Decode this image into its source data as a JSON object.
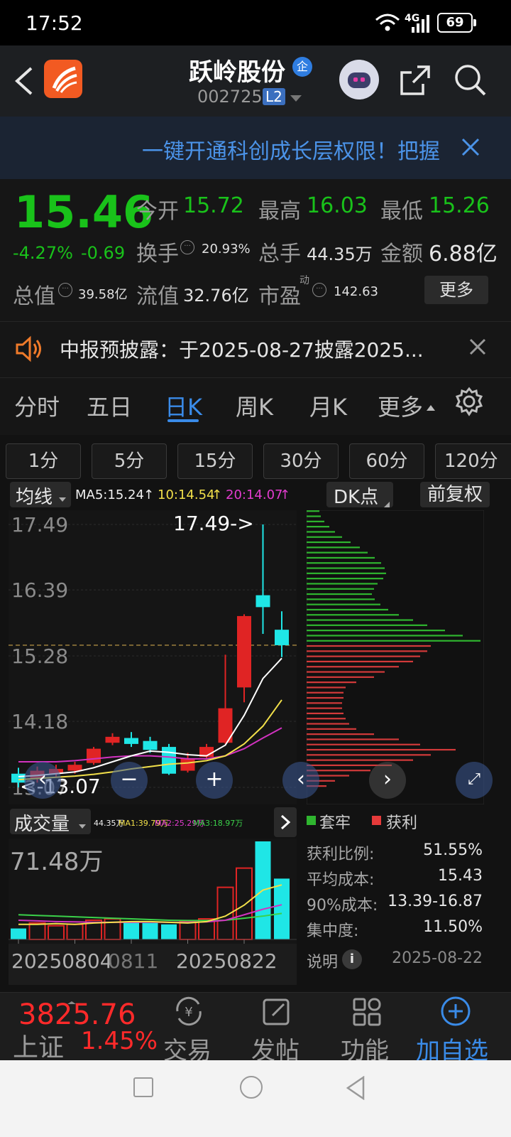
{
  "status_bar": {
    "time": "17:52",
    "network": "4G",
    "battery": "69"
  },
  "header": {
    "stock_name": "跃岭股份",
    "enterprise_badge": "企",
    "stock_code": "002725",
    "level_badge": "L2"
  },
  "banner": {
    "text": "一键开通科创成长层权限！把握"
  },
  "quote": {
    "price": "15.46",
    "change_pct": "-4.27%",
    "change": "-0.69",
    "open_label": "今开",
    "open": "15.72",
    "high_label": "最高",
    "high": "16.03",
    "low_label": "最低",
    "low": "15.26",
    "turnover_label": "换手",
    "turnover": "20.93%",
    "volume_label": "总手",
    "volume": "44.35万",
    "amount_label": "金额",
    "amount": "6.88亿",
    "mktcap_label": "总值",
    "mktcap": "39.58亿",
    "float_label": "流值",
    "float_cap": "32.76亿",
    "pe_label": "市盈",
    "pe_sup": "动",
    "pe": "142.63",
    "more_button": "更多"
  },
  "notice": {
    "text": "中报预披露：于2025-08-27披露2025..."
  },
  "tabs": [
    "分时",
    "五日",
    "日K",
    "周K",
    "月K",
    "更多"
  ],
  "active_tab": "日K",
  "periods": [
    "1分",
    "5分",
    "15分",
    "30分",
    "60分",
    "120分"
  ],
  "chart_toolbar": {
    "ma_select": "均线",
    "ma5": "MA5:15.24",
    "ma10": "10:14.54",
    "ma20": "20:14.07",
    "dk_button": "DK点",
    "adjust_button": "前复权"
  },
  "volume_panel": {
    "select": "成交量",
    "vol": "44.35万",
    "ma1": "MA1:39.79万",
    "ma2": "MA2:25.29万",
    "ma3": "MA3:18.97万",
    "max_label": "71.48万",
    "date_left": "20250804",
    "date_left2": "0811",
    "date_right": "20250822"
  },
  "chip_panel": {
    "legend_trapped": "套牢",
    "legend_profit": "获利",
    "rows": [
      {
        "label": "获利比例:",
        "value": "51.55%"
      },
      {
        "label": "平均成本:",
        "value": "15.43"
      },
      {
        "label": "90%成本:",
        "value": "13.39-16.87"
      },
      {
        "label": "集中度:",
        "value": "11.50%"
      }
    ],
    "note_label": "说明",
    "date": "2025-08-22"
  },
  "bottom_bar": {
    "index_value": "3825.76",
    "index_name": "上证",
    "index_pct": "1.45%",
    "trade": "交易",
    "post": "发帖",
    "functions": "功能",
    "add_watch": "加自选"
  },
  "chart_data": {
    "type": "candlestick",
    "y_ticks": [
      "17.49",
      "16.39",
      "15.28",
      "14.18",
      "13.07"
    ],
    "ylim": [
      13.07,
      17.49
    ],
    "high_annotation": "17.49->",
    "low_annotation": "<-13.07",
    "candles": [
      {
        "o": 13.3,
        "c": 13.15,
        "h": 13.4,
        "l": 13.07
      },
      {
        "o": 13.22,
        "c": 13.35,
        "h": 13.42,
        "l": 13.15
      },
      {
        "o": 13.3,
        "c": 13.38,
        "h": 13.45,
        "l": 13.25
      },
      {
        "o": 13.35,
        "c": 13.45,
        "h": 13.5,
        "l": 13.3
      },
      {
        "o": 13.48,
        "c": 13.72,
        "h": 13.75,
        "l": 13.45
      },
      {
        "o": 13.82,
        "c": 13.92,
        "h": 13.98,
        "l": 13.78
      },
      {
        "o": 13.9,
        "c": 13.8,
        "h": 14.0,
        "l": 13.75
      },
      {
        "o": 13.85,
        "c": 13.7,
        "h": 13.92,
        "l": 13.65
      },
      {
        "o": 13.75,
        "c": 13.3,
        "h": 13.8,
        "l": 13.28
      },
      {
        "o": 13.35,
        "c": 13.55,
        "h": 13.65,
        "l": 13.32
      },
      {
        "o": 13.58,
        "c": 13.75,
        "h": 13.8,
        "l": 13.55
      },
      {
        "o": 13.82,
        "c": 14.4,
        "h": 15.3,
        "l": 13.8
      },
      {
        "o": 14.75,
        "c": 15.95,
        "h": 15.98,
        "l": 14.5
      },
      {
        "o": 16.3,
        "c": 16.1,
        "h": 17.49,
        "l": 15.65
      },
      {
        "o": 15.72,
        "c": 15.46,
        "h": 16.03,
        "l": 15.26
      }
    ],
    "ma5": [
      13.25,
      13.27,
      13.3,
      13.33,
      13.4,
      13.5,
      13.6,
      13.68,
      13.66,
      13.62,
      13.6,
      13.78,
      14.28,
      14.9,
      15.24
    ],
    "ma10": [
      13.2,
      13.22,
      13.24,
      13.26,
      13.29,
      13.33,
      13.38,
      13.42,
      13.46,
      13.48,
      13.52,
      13.6,
      13.8,
      14.1,
      14.54
    ],
    "ma20": [
      13.5,
      13.5,
      13.5,
      13.52,
      13.55,
      13.58,
      13.6,
      13.6,
      13.58,
      13.55,
      13.55,
      13.6,
      13.72,
      13.9,
      14.07
    ],
    "price_line": 15.46,
    "volume": [
      8,
      12,
      10,
      11,
      14,
      15,
      13,
      12,
      11,
      13,
      15,
      38,
      52,
      71.48,
      44.35
    ],
    "vol_ma1": [
      11,
      11,
      11.5,
      11,
      12,
      12.5,
      13,
      13,
      12.5,
      12,
      13,
      17,
      25,
      36,
      39.79
    ],
    "vol_ma2": [
      14,
      13.5,
      13,
      12.8,
      12.5,
      12.5,
      12.5,
      12.6,
      12.5,
      12.5,
      12.8,
      14,
      18,
      22,
      25.29
    ],
    "vol_ma3": [
      18,
      17.5,
      17,
      16.5,
      16,
      15.5,
      15,
      14.5,
      14,
      13.8,
      13.8,
      14,
      15.5,
      17,
      18.97
    ],
    "chip_green": [
      18,
      20,
      25,
      32,
      40,
      50,
      62,
      75,
      86,
      96,
      105,
      110,
      112,
      108,
      100,
      95,
      92,
      96,
      104,
      115,
      130,
      150,
      170,
      195,
      220,
      245
    ],
    "chip_red": [
      175,
      170,
      160,
      150,
      130,
      110,
      95,
      70,
      55,
      52,
      52,
      50,
      50,
      52,
      55,
      60,
      70,
      95,
      130,
      160,
      210,
      175,
      150,
      120,
      90,
      60,
      40,
      28
    ]
  }
}
